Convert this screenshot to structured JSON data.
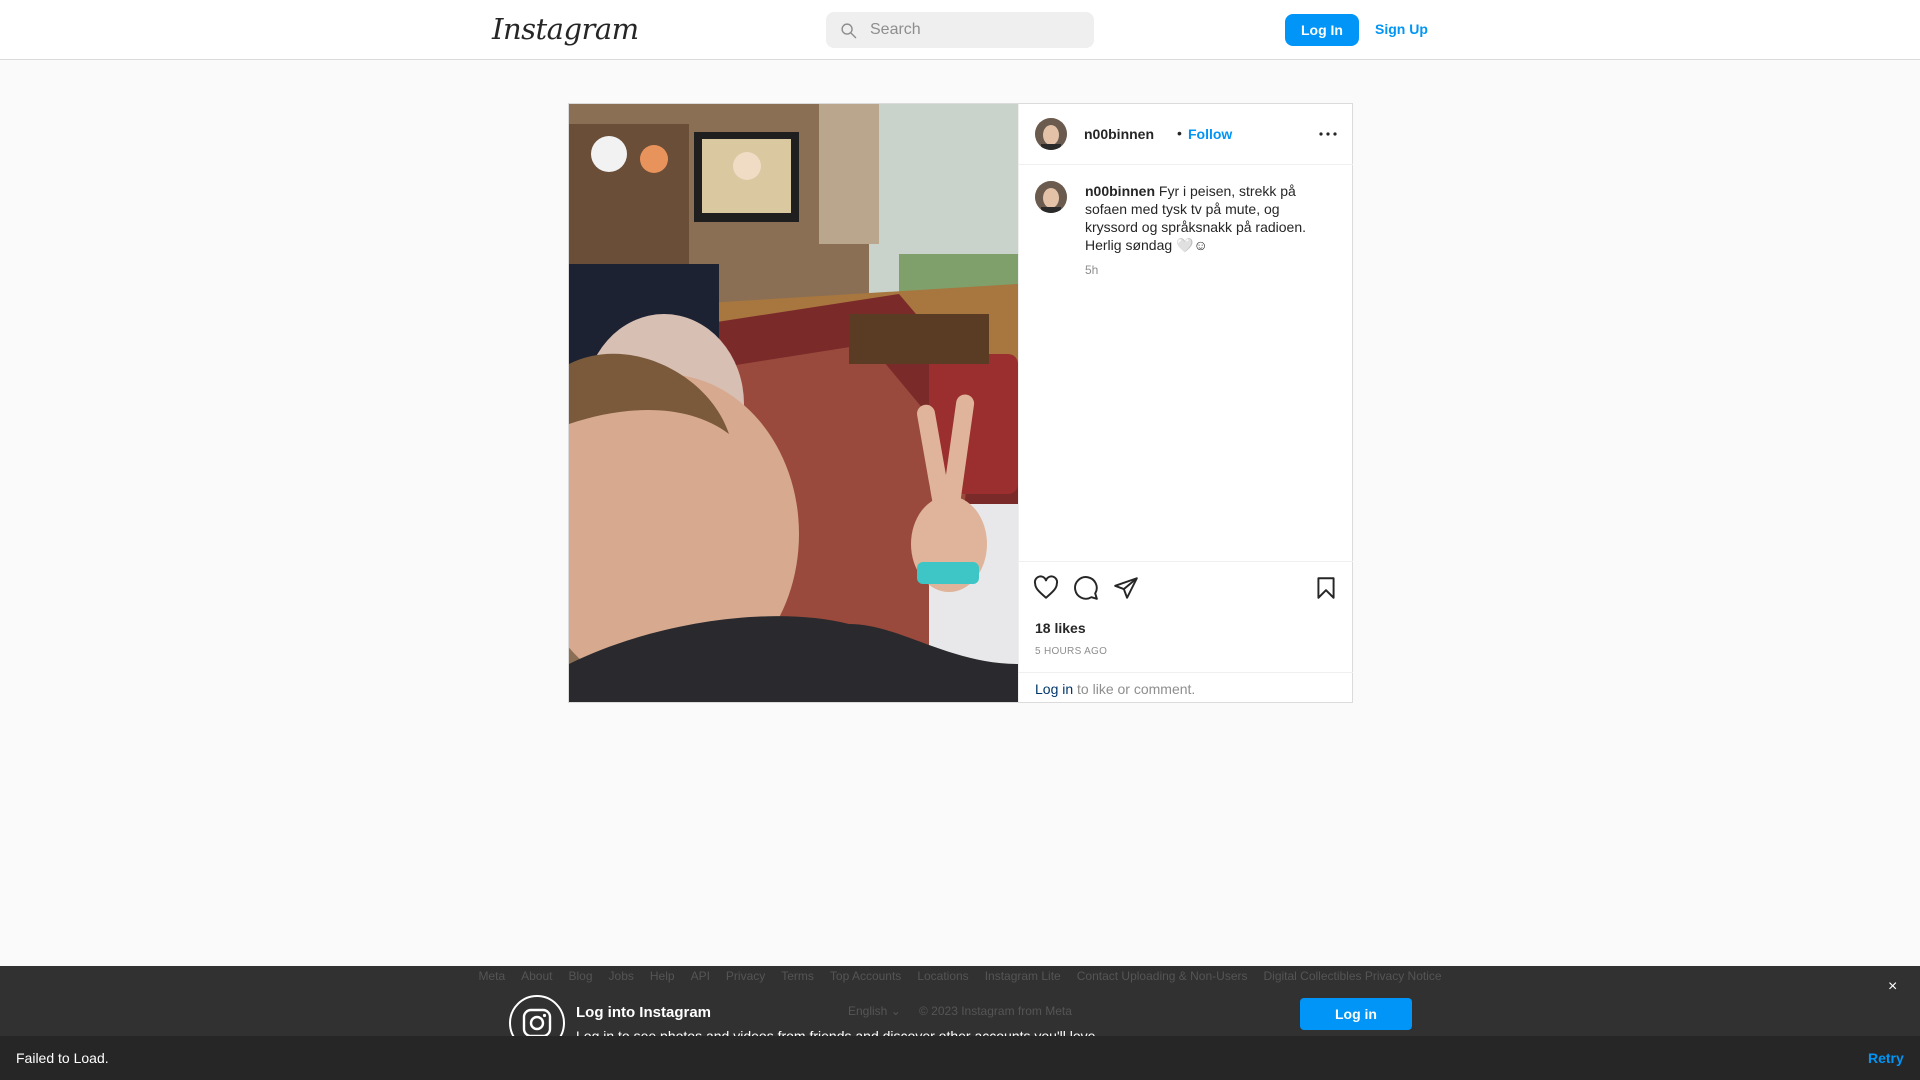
{
  "header": {
    "logo_text": "Instagram",
    "search_placeholder": "Search",
    "login_label": "Log In",
    "signup_label": "Sign Up"
  },
  "post": {
    "username": "n00binnen",
    "separator": "•",
    "follow_label": "Follow",
    "caption_user": "n00binnen",
    "caption_text": "Fyr i peisen, strekk på sofaen med tysk tv på mute, og kryssord og språksnakk på radioen. Herlig søndag 🤍☺",
    "caption_time": "5h",
    "likes": "18 likes",
    "time_ago": "5 HOURS AGO",
    "login_link": "Log in",
    "login_rest": " to like or comment."
  },
  "banner": {
    "footer_links": [
      "Meta",
      "About",
      "Blog",
      "Jobs",
      "Help",
      "API",
      "Privacy",
      "Terms",
      "Top Accounts",
      "Locations",
      "Instagram Lite",
      "Contact Uploading & Non-Users",
      "Digital Collectibles Privacy Notice"
    ],
    "language": "English",
    "copyright": "© 2023 Instagram from Meta",
    "title": "Log into Instagram",
    "subtitle": "Log in to see photos and videos from friends and discover other accounts you'll love.",
    "login_label": "Log in",
    "close_glyph": "×"
  },
  "error": {
    "message": "Failed to Load.",
    "retry_label": "Retry"
  },
  "colors": {
    "accent": "#0095f6",
    "text": "#262626",
    "muted": "#8e8e8e",
    "border": "#dbdbdb"
  },
  "icons": {
    "search": "search-icon",
    "more": "more-options-icon",
    "like": "heart-icon",
    "comment": "comment-icon",
    "share": "share-icon",
    "save": "bookmark-icon",
    "instagram": "instagram-logo-icon"
  }
}
